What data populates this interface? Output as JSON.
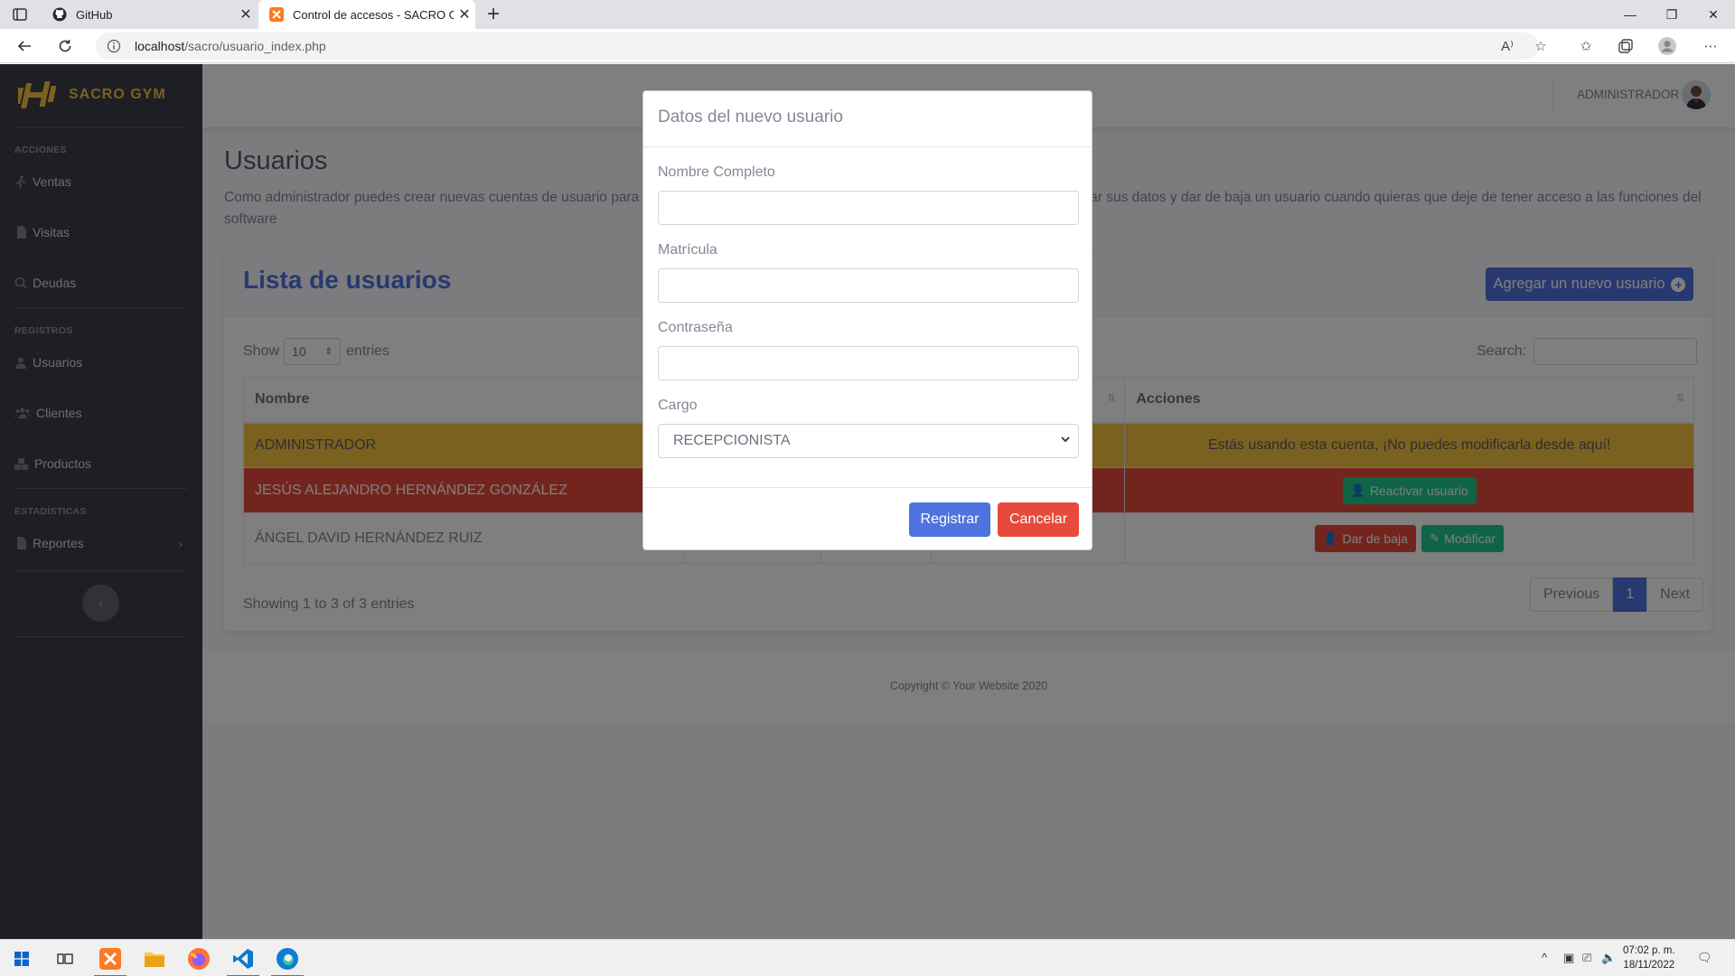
{
  "browser": {
    "tabs": [
      {
        "title": "GitHub"
      },
      {
        "title": "Control de accesos - SACRO GYM"
      }
    ],
    "url_host": "localhost",
    "url_path": "/sacro/usuario_index.php",
    "read_aloud_label": "A⁾"
  },
  "app": {
    "brand": "SACRO GYM",
    "sidebar": {
      "headings": {
        "acciones": "ACCIONES",
        "registros": "REGISTROS",
        "estadisticas": "ESTADÍSTICAS"
      },
      "items": [
        {
          "label": "Ventas",
          "icon": "walking-icon"
        },
        {
          "label": "Visitas",
          "icon": "file-icon"
        },
        {
          "label": "Deudas",
          "icon": "search-dollar-icon"
        },
        {
          "label": "Usuarios",
          "icon": "user-icon"
        },
        {
          "label": "Clientes",
          "icon": "users-icon"
        },
        {
          "label": "Productos",
          "icon": "boxes-icon"
        },
        {
          "label": "Reportes",
          "icon": "file-alt-icon"
        }
      ]
    },
    "topbar": {
      "user_name": "ADMINISTRADOR"
    },
    "page": {
      "title": "Usuarios",
      "description": "Como administrador puedes crear nuevas cuentas de usuario para que tu personal pueda acceder al sistema, también aquí puedes modificar sus datos y dar de baja un usuario cuando quieras que deje de tener acceso a las funciones del software"
    },
    "card": {
      "title": "Lista de usuarios",
      "add_button": "Agregar un nuevo usuario",
      "show_label": "Show",
      "entries_value": "10",
      "entries_label": "entries",
      "search_label": "Search:",
      "columns": [
        "Nombre",
        "",
        "",
        "",
        "Acciones"
      ],
      "rows": [
        {
          "nombre": "ADMINISTRADOR",
          "acciones": "Estás usando esta cuenta, ¡No puedes modificarla desde aquí!"
        },
        {
          "nombre": "JESÚS ALEJANDRO HERNÁNDEZ GONZÁLEZ",
          "acciones": "Reactivar usuario"
        },
        {
          "nombre": "ÁNGEL DAVID HERNÁNDEZ RUIZ",
          "acciones_baja": "Dar de baja",
          "acciones_modificar": "Modificar"
        }
      ],
      "showing": "Showing 1 to 3 of 3 entries",
      "pager": {
        "previous": "Previous",
        "current": "1",
        "next": "Next"
      }
    },
    "footer": "Copyright © Your Website 2020"
  },
  "modal": {
    "title": "Datos del nuevo usuario",
    "fields": {
      "nombre_label": "Nombre Completo",
      "matricula_label": "Matrícula",
      "password_label": "Contraseña",
      "cargo_label": "Cargo",
      "cargo_value": "RECEPCIONISTA"
    },
    "register_button": "Registrar",
    "cancel_button": "Cancelar"
  },
  "taskbar": {
    "time": "07:02 p. m.",
    "date": "18/11/2022"
  },
  "colors": {
    "primary": "#4e73df",
    "danger": "#e74a3b",
    "success": "#1cc88a",
    "warning": "#f6c23e",
    "sidebar": "#3d3f4b"
  }
}
